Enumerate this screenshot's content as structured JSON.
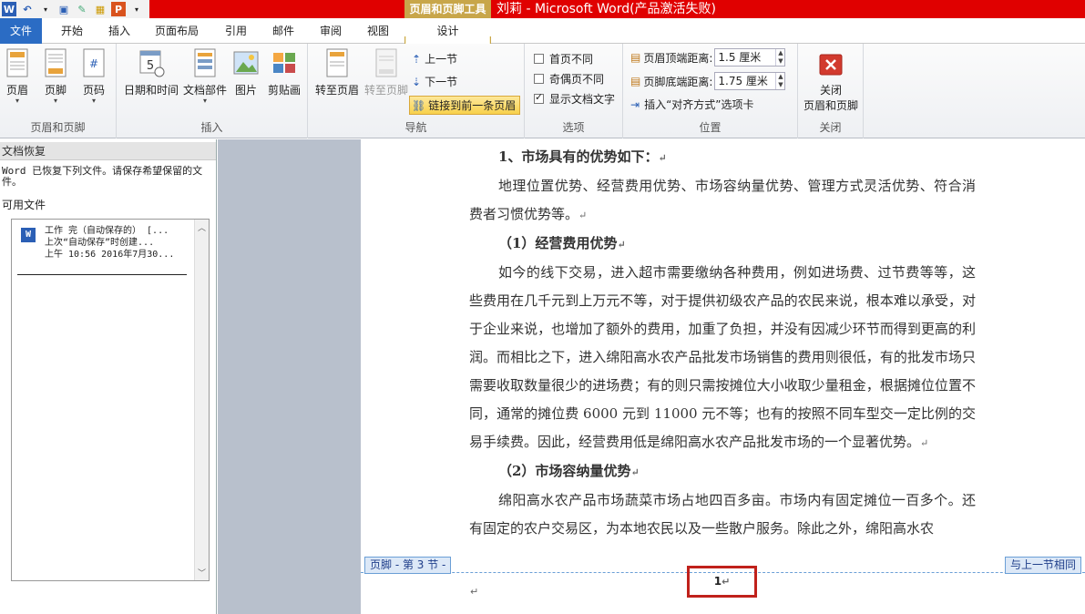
{
  "titlebar": {
    "context_tool": "页眉和页脚工具",
    "doc_title": "刘莉 - Microsoft Word(产品激活失败)"
  },
  "tabs": [
    {
      "label": "文件"
    },
    {
      "label": "开始"
    },
    {
      "label": "插入"
    },
    {
      "label": "页面布局"
    },
    {
      "label": "引用"
    },
    {
      "label": "邮件"
    },
    {
      "label": "审阅"
    },
    {
      "label": "视图"
    },
    {
      "label": "设计"
    }
  ],
  "ribbon": {
    "group_header_footer": {
      "label": "页眉和页脚",
      "header": "页眉",
      "footer": "页脚",
      "page_number": "页码"
    },
    "group_insert": {
      "label": "插入",
      "date_time": "日期和时间",
      "doc_parts": "文档部件",
      "picture": "图片",
      "clipart": "剪贴画"
    },
    "group_nav": {
      "label": "导航",
      "goto_header": "转至页眉",
      "goto_footer": "转至页脚",
      "prev_section": "上一节",
      "next_section": "下一节",
      "link_previous": "链接到前一条页眉"
    },
    "group_options": {
      "label": "选项",
      "first_page": "首页不同",
      "odd_even": "奇偶页不同",
      "show_text": "显示文档文字"
    },
    "group_position": {
      "label": "位置",
      "header_dist_label": "页眉顶端距离:",
      "header_dist_value": "1.5 厘米",
      "footer_dist_label": "页脚底端距离:",
      "footer_dist_value": "1.75 厘米",
      "align_tab": "插入“对齐方式”选项卡"
    },
    "group_close": {
      "label": "关闭",
      "close_btn_line1": "关闭",
      "close_btn_line2": "页眉和页脚"
    }
  },
  "recovery": {
    "title": "文档恢复",
    "message": "Word 已恢复下列文件。请保存希望保留的文件。",
    "available": "可用文件",
    "file": {
      "line1": "工作 完（自动保存的）  [...",
      "line2": "上次“自动保存”时创建...",
      "line3": "上午 10:56 2016年7月30..."
    }
  },
  "document": {
    "h1": "1、市场具有的优势如下：",
    "p1": "地理位置优势、经营费用优势、市场容纳量优势、管理方式灵活优势、符合消费者习惯优势等。",
    "h2": "（1）经营费用优势",
    "p2": "如今的线下交易，进入超市需要缴纳各种费用，例如进场费、过节费等等，这些费用在几千元到上万元不等，对于提供初级农产品的农民来说，根本难以承受，对于企业来说，也增加了额外的费用，加重了负担，并没有因减少环节而得到更高的利润。而相比之下，进入绵阳高水农产品批发市场销售的费用则很低，有的批发市场只需要收取数量很少的进场费；有的则只需按摊位大小收取少量租金，根据摊位位置不同，通常的摊位费 6000 元到 11000 元不等；也有的按照不同车型交一定比例的交易手续费。因此，经营费用低是绵阳高水农产品批发市场的一个显著优势。",
    "h3": "（2）市场容纳量优势",
    "p3": "绵阳高水农产品市场蔬菜市场占地四百多亩。市场内有固定摊位一百多个。还有固定的农户交易区，为本地农民以及一些散户服务。除此之外，绵阳高水农",
    "footer_tag": "页脚 - 第 3 节 -",
    "same_as_prev": "与上一节相同",
    "page_number": "1"
  },
  "colors": {
    "title_bar": "#e00000",
    "file_tab": "#2b6cc4",
    "context_tab": "#c8a64a",
    "highlight_box": "#c0211b"
  }
}
